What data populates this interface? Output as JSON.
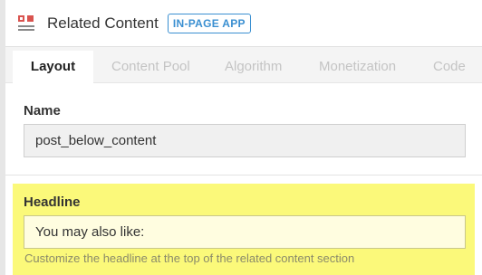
{
  "header": {
    "title": "Related Content",
    "badge": "IN-PAGE APP"
  },
  "tabs": [
    {
      "label": "Layout",
      "active": true
    },
    {
      "label": "Content Pool",
      "active": false
    },
    {
      "label": "Algorithm",
      "active": false
    },
    {
      "label": "Monetization",
      "active": false
    },
    {
      "label": "Code",
      "active": false
    }
  ],
  "name_field": {
    "label": "Name",
    "value": "post_below_content"
  },
  "headline_field": {
    "label": "Headline",
    "value": "You may also like:",
    "help": "Customize the headline at the top of the related content section"
  },
  "colors": {
    "highlight": "#fbf97a",
    "badge": "#3a8fd1",
    "icon_accent": "#d9534f"
  }
}
